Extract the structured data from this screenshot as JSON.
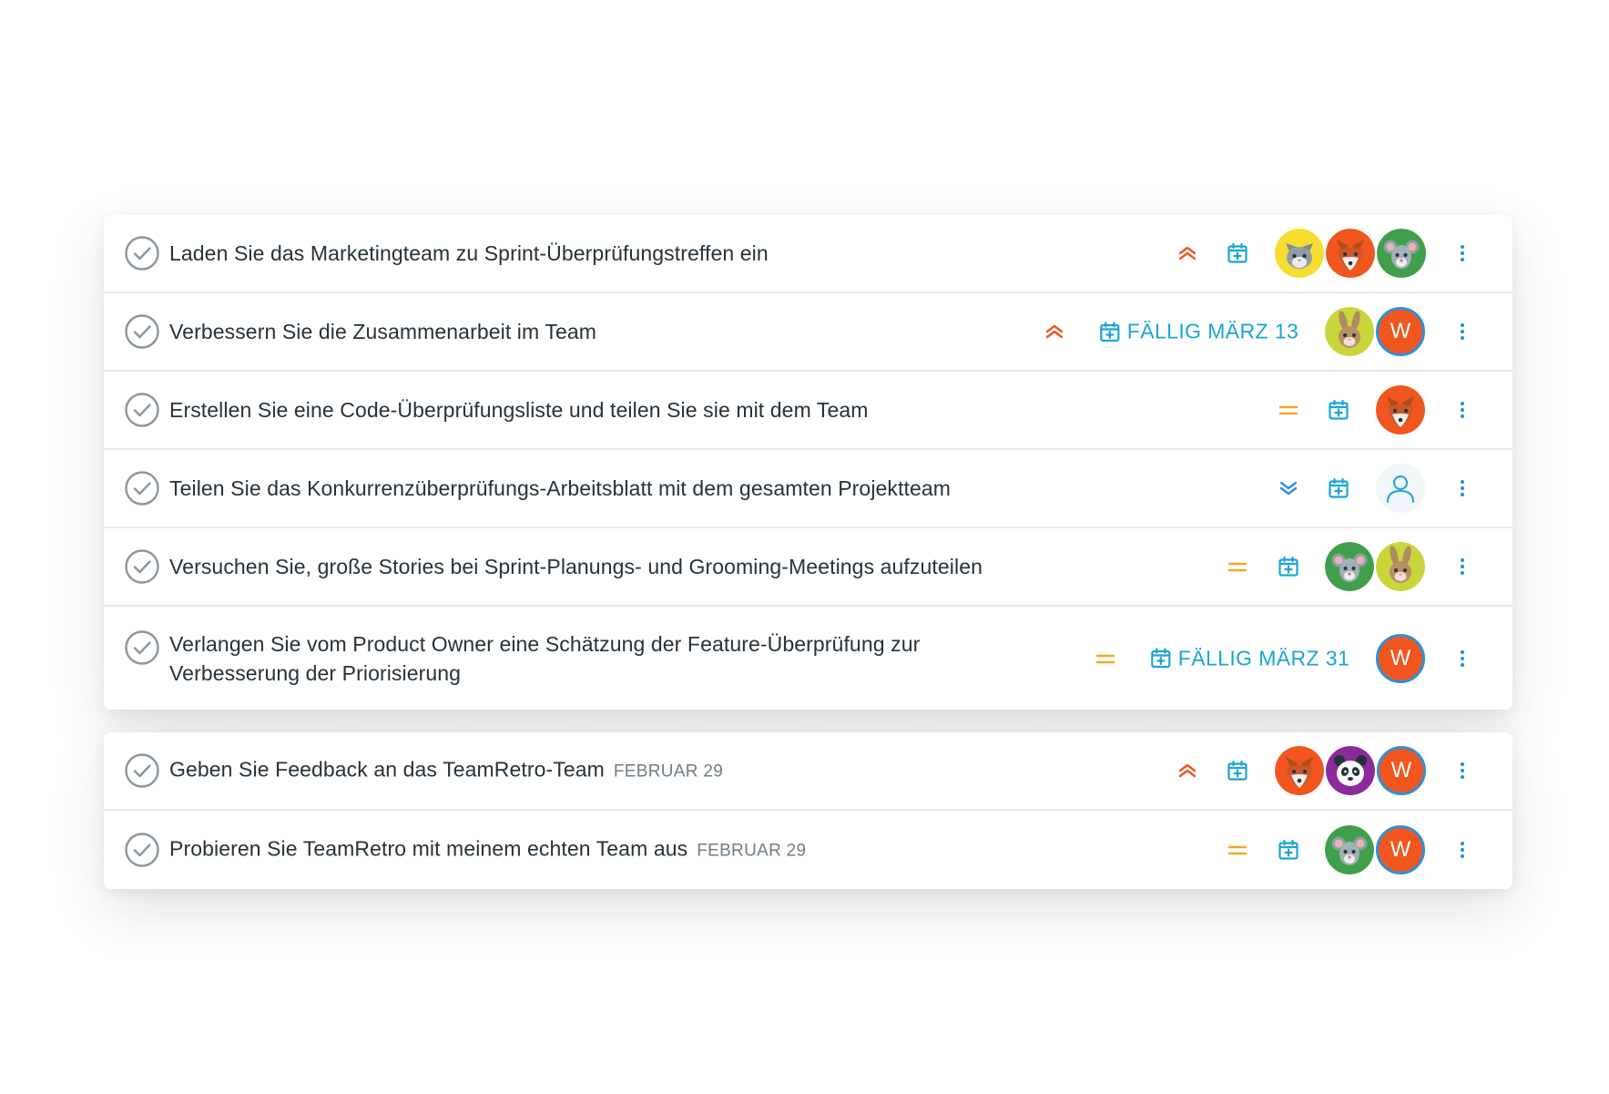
{
  "colors": {
    "priority_high": "#f0561d",
    "priority_medium": "#f5a623",
    "priority_low": "#2e8fd6",
    "accent": "#1aa5d4",
    "check": "#8a969e",
    "avatar_letter_bg": "#f0561d",
    "avatar_letter_ring": "#2e8fd6"
  },
  "groups": [
    {
      "tasks": [
        {
          "title": "Laden Sie das Marketingteam zu Sprint-Überprüfungstreffen ein",
          "date_tag": "",
          "priority": "high",
          "due_label": "",
          "assignees": [
            "cat",
            "fox",
            "mouse"
          ]
        },
        {
          "title": "Verbessern Sie die Zusammenarbeit im Team",
          "date_tag": "",
          "priority": "high",
          "due_label": "FÄLLIG MÄRZ 13",
          "assignees": [
            "rabbit",
            "W"
          ]
        },
        {
          "title": "Erstellen Sie eine Code-Überprüfungsliste und teilen Sie sie mit dem Team",
          "date_tag": "",
          "priority": "medium",
          "due_label": "",
          "assignees": [
            "fox"
          ]
        },
        {
          "title": "Teilen Sie das Konkurrenzüberprüfungs-Arbeitsblatt mit dem gesamten Projektteam",
          "date_tag": "",
          "priority": "low",
          "due_label": "",
          "assignees": [
            "unassigned"
          ]
        },
        {
          "title": "Versuchen Sie, große Stories bei Sprint-Planungs- und Grooming-Meetings aufzuteilen",
          "date_tag": "",
          "priority": "medium",
          "due_label": "",
          "assignees": [
            "mouse",
            "rabbit"
          ]
        },
        {
          "title": "Verlangen Sie vom Product Owner eine Schätzung der Feature-Überprüfung zur Verbesserung der Priorisierung",
          "date_tag": "",
          "priority": "medium",
          "due_label": "FÄLLIG MÄRZ 31",
          "assignees": [
            "W"
          ]
        }
      ]
    },
    {
      "tasks": [
        {
          "title": "Geben Sie Feedback an das TeamRetro-Team",
          "date_tag": "FEBRUAR 29",
          "priority": "high",
          "due_label": "",
          "assignees": [
            "fox",
            "panda",
            "W"
          ]
        },
        {
          "title": "Probieren Sie TeamRetro mit meinem echten Team aus",
          "date_tag": "FEBRUAR 29",
          "priority": "medium",
          "due_label": "",
          "assignees": [
            "mouse",
            "W"
          ]
        }
      ]
    }
  ]
}
